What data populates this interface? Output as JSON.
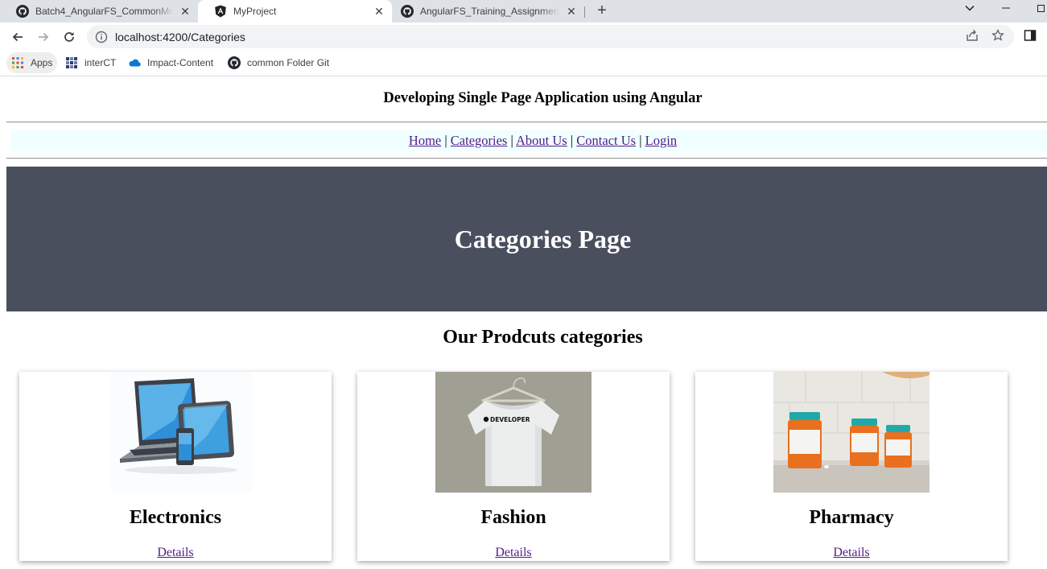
{
  "browser": {
    "tabs": [
      {
        "title": "Batch4_AngularFS_CommonModules",
        "icon": "github-icon",
        "active": false
      },
      {
        "title": "MyProject",
        "icon": "angular-icon",
        "active": true
      },
      {
        "title": "AngularFS_Training_Assignments",
        "icon": "github-icon",
        "active": false
      }
    ],
    "new_tab_glyph": "+",
    "address": "localhost:4200/Categories",
    "bookmarks": [
      {
        "label": "Apps",
        "icon": "apps-grid-icon"
      },
      {
        "label": "interCT",
        "icon": "interct-icon"
      },
      {
        "label": "Impact-Content",
        "icon": "onedrive-cloud-icon"
      },
      {
        "label": "common Folder Git",
        "icon": "github-icon"
      }
    ]
  },
  "page": {
    "app_title": "Developing Single Page Application using Angular",
    "nav": [
      {
        "label": "Home"
      },
      {
        "label": "Categories"
      },
      {
        "label": "About Us"
      },
      {
        "label": "Contact Us"
      },
      {
        "label": "Login"
      }
    ],
    "nav_separator": "|",
    "banner_title": "Categories Page",
    "section_title": "Our Prodcuts categories",
    "categories": [
      {
        "name": "Electronics",
        "link": "Details",
        "image": "electronics-devices-image"
      },
      {
        "name": "Fashion",
        "link": "Details",
        "image": "white-tshirt-image"
      },
      {
        "name": "Pharmacy",
        "link": "Details",
        "image": "pill-bottles-image"
      }
    ],
    "shirt_print": "DEVELOPER"
  },
  "colors": {
    "tabstrip": "#dee1e6",
    "navbar_bg": "#f0ffff",
    "banner_bg": "#4a4f5e",
    "visited_link": "#551a8b"
  }
}
